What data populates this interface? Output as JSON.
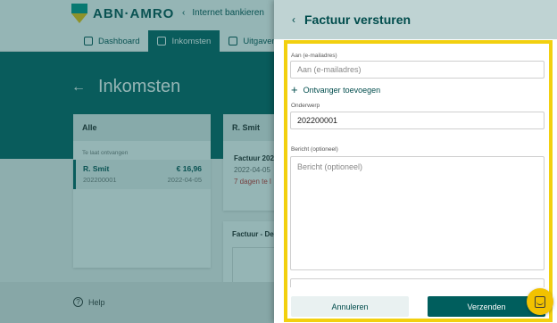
{
  "app": {
    "brand": "ABN·AMRO",
    "internet_banking_link": "Internet bankieren",
    "tabs": [
      {
        "label": "Dashboard",
        "active": false
      },
      {
        "label": "Inkomsten",
        "active": true
      },
      {
        "label": "Uitgaven",
        "active": false
      }
    ],
    "page_title": "Inkomsten",
    "help_label": "Help"
  },
  "list_panel": {
    "header": "Alle",
    "section": "Te laat ontvangen",
    "item": {
      "name": "R. Smit",
      "amount": "€ 16,96",
      "number": "202200001",
      "date": "2022-04-05"
    }
  },
  "detail_panel": {
    "header": "R. Smit",
    "title": "Factuur 2022",
    "date": "2022-04-05",
    "warning": "7 dagen te l"
  },
  "doc_panel": {
    "title": "Factuur - De"
  },
  "drawer": {
    "title": "Factuur versturen",
    "to_label": "Aan (e-mailadres)",
    "to_placeholder": "Aan (e-mailadres)",
    "add_recipient": "Ontvanger toevoegen",
    "subject_label": "Onderwerp",
    "subject_value": "202200001",
    "message_label": "Bericht (optioneel)",
    "message_placeholder": "Bericht (optioneel)",
    "cancel_button": "Annuleren",
    "send_button": "Verzenden"
  },
  "colors": {
    "brand_green": "#005e5d",
    "brand_yellow": "#f3c000",
    "highlight": "#f2d00f",
    "warning_red": "#c62828"
  }
}
